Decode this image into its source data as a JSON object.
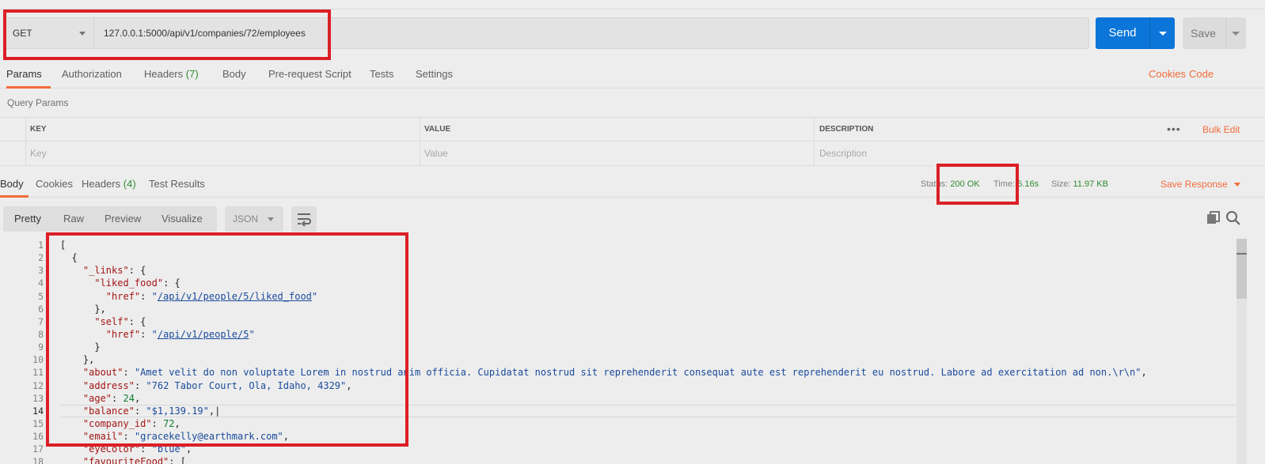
{
  "request": {
    "method": "GET",
    "url": "127.0.0.1:5000/api/v1/companies/72/employees",
    "send_label": "Send",
    "save_label": "Save"
  },
  "request_tabs": [
    {
      "label": "Params",
      "count": ""
    },
    {
      "label": "Authorization",
      "count": ""
    },
    {
      "label": "Headers",
      "count": "(7)"
    },
    {
      "label": "Body",
      "count": ""
    },
    {
      "label": "Pre-request Script",
      "count": ""
    },
    {
      "label": "Tests",
      "count": ""
    },
    {
      "label": "Settings",
      "count": ""
    }
  ],
  "request_links": {
    "cookies": "Cookies",
    "code": "Code"
  },
  "query_params": {
    "label": "Query Params",
    "columns": [
      "KEY",
      "VALUE",
      "DESCRIPTION"
    ],
    "placeholders": [
      "Key",
      "Value",
      "Description"
    ],
    "bulk_edit": "Bulk Edit",
    "more": "•••"
  },
  "response_tabs": [
    {
      "label": "Body",
      "count": ""
    },
    {
      "label": "Cookies",
      "count": ""
    },
    {
      "label": "Headers",
      "count": "(4)"
    },
    {
      "label": "Test Results",
      "count": ""
    }
  ],
  "response_meta": {
    "status_label": "Status:",
    "status_value": "200 OK",
    "time_label": "Time:",
    "time_value": "5.16s",
    "size_label": "Size:",
    "size_value": "11.97 KB",
    "save_response": "Save Response"
  },
  "body_formats": [
    "Pretty",
    "Raw",
    "Preview",
    "Visualize"
  ],
  "body_language": "JSON",
  "icons": {
    "wrap": "wrap-lines-icon",
    "copy": "copy-icon",
    "search": "search-icon"
  },
  "colors": {
    "send": "#0b75d9",
    "accent": "#f26b3a",
    "status_ok": "#2e8b32",
    "highlight": "#dc1f26"
  },
  "code": {
    "line_numbers": [
      "1",
      "2",
      "3",
      "4",
      "5",
      "6",
      "7",
      "8",
      "9",
      "10",
      "11",
      "12",
      "13",
      "14",
      "15",
      "16",
      "17",
      "18"
    ],
    "current_line": 14,
    "lines": [
      [
        {
          "t": "p",
          "v": "["
        }
      ],
      [
        {
          "t": "p",
          "v": "  {"
        }
      ],
      [
        {
          "t": "p",
          "v": "    "
        },
        {
          "t": "k",
          "v": "\"_links\""
        },
        {
          "t": "p",
          "v": ": {"
        }
      ],
      [
        {
          "t": "p",
          "v": "      "
        },
        {
          "t": "k",
          "v": "\"liked_food\""
        },
        {
          "t": "p",
          "v": ": {"
        }
      ],
      [
        {
          "t": "p",
          "v": "        "
        },
        {
          "t": "k",
          "v": "\"href\""
        },
        {
          "t": "p",
          "v": ": "
        },
        {
          "t": "s",
          "v": "\""
        },
        {
          "t": "u",
          "v": "/api/v1/people/5/liked_food"
        },
        {
          "t": "s",
          "v": "\""
        }
      ],
      [
        {
          "t": "p",
          "v": "      },"
        }
      ],
      [
        {
          "t": "p",
          "v": "      "
        },
        {
          "t": "k",
          "v": "\"self\""
        },
        {
          "t": "p",
          "v": ": {"
        }
      ],
      [
        {
          "t": "p",
          "v": "        "
        },
        {
          "t": "k",
          "v": "\"href\""
        },
        {
          "t": "p",
          "v": ": "
        },
        {
          "t": "s",
          "v": "\""
        },
        {
          "t": "u",
          "v": "/api/v1/people/5"
        },
        {
          "t": "s",
          "v": "\""
        }
      ],
      [
        {
          "t": "p",
          "v": "      }"
        }
      ],
      [
        {
          "t": "p",
          "v": "    },"
        }
      ],
      [
        {
          "t": "p",
          "v": "    "
        },
        {
          "t": "k",
          "v": "\"about\""
        },
        {
          "t": "p",
          "v": ": "
        },
        {
          "t": "s",
          "v": "\"Amet velit do non voluptate Lorem in nostrud anim officia. Cupidatat nostrud sit reprehenderit consequat aute est reprehenderit eu nostrud. Labore ad exercitation ad non.\\r\\n\""
        },
        {
          "t": "p",
          "v": ","
        }
      ],
      [
        {
          "t": "p",
          "v": "    "
        },
        {
          "t": "k",
          "v": "\"address\""
        },
        {
          "t": "p",
          "v": ": "
        },
        {
          "t": "s",
          "v": "\"762 Tabor Court, Ola, Idaho, 4329\""
        },
        {
          "t": "p",
          "v": ","
        }
      ],
      [
        {
          "t": "p",
          "v": "    "
        },
        {
          "t": "k",
          "v": "\"age\""
        },
        {
          "t": "p",
          "v": ": "
        },
        {
          "t": "n",
          "v": "24"
        },
        {
          "t": "p",
          "v": ","
        }
      ],
      [
        {
          "t": "p",
          "v": "    "
        },
        {
          "t": "k",
          "v": "\"balance\""
        },
        {
          "t": "p",
          "v": ": "
        },
        {
          "t": "s",
          "v": "\"$1,139.19\""
        },
        {
          "t": "p",
          "v": ",|"
        }
      ],
      [
        {
          "t": "p",
          "v": "    "
        },
        {
          "t": "k",
          "v": "\"company_id\""
        },
        {
          "t": "p",
          "v": ": "
        },
        {
          "t": "n",
          "v": "72"
        },
        {
          "t": "p",
          "v": ","
        }
      ],
      [
        {
          "t": "p",
          "v": "    "
        },
        {
          "t": "k",
          "v": "\"email\""
        },
        {
          "t": "p",
          "v": ": "
        },
        {
          "t": "s",
          "v": "\"gracekelly@earthmark.com\""
        },
        {
          "t": "p",
          "v": ","
        }
      ],
      [
        {
          "t": "p",
          "v": "    "
        },
        {
          "t": "k",
          "v": "\"eyeColor\""
        },
        {
          "t": "p",
          "v": ": "
        },
        {
          "t": "s",
          "v": "\"blue\""
        },
        {
          "t": "p",
          "v": ","
        }
      ],
      [
        {
          "t": "p",
          "v": "    "
        },
        {
          "t": "k",
          "v": "\"favouriteFood\""
        },
        {
          "t": "p",
          "v": ": ["
        }
      ]
    ]
  }
}
